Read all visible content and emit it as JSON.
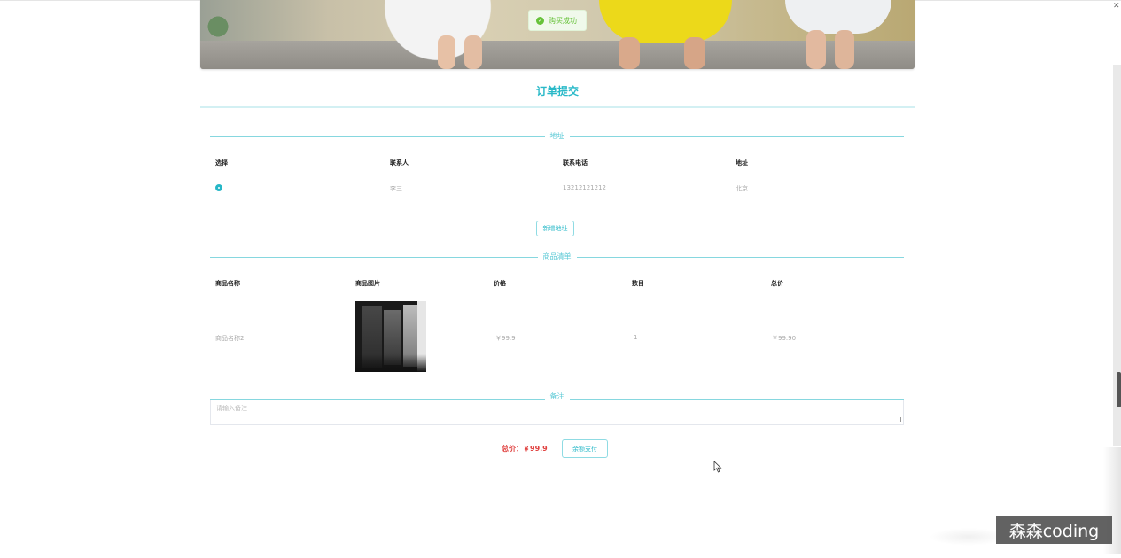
{
  "toast": {
    "text": "购买成功",
    "icon": "check-circle-icon"
  },
  "order": {
    "title": "订单提交",
    "address_section": {
      "label": "地址",
      "headers": [
        "选择",
        "联系人",
        "联系电话",
        "地址"
      ],
      "rows": [
        {
          "selected": true,
          "contact": "李三",
          "phone": "13212121212",
          "address": "北京"
        }
      ],
      "add_button": "新增地址"
    },
    "goods_section": {
      "label": "商品清单",
      "headers": [
        "商品名称",
        "商品图片",
        "价格",
        "数目",
        "总价"
      ],
      "rows": [
        {
          "name": "商品名称2",
          "price": "￥99.9",
          "qty": "1",
          "subtotal": "￥99.90"
        }
      ]
    },
    "remark_section": {
      "label": "备注",
      "placeholder": "请输入备注"
    },
    "total_label": "总价：￥99.9",
    "pay_button": "余额支付"
  },
  "watermark": "森森coding",
  "colors": {
    "accent": "#29b9c8",
    "divider": "#86d7df",
    "total": "#e0413f",
    "toast_green": "#67c23a"
  }
}
